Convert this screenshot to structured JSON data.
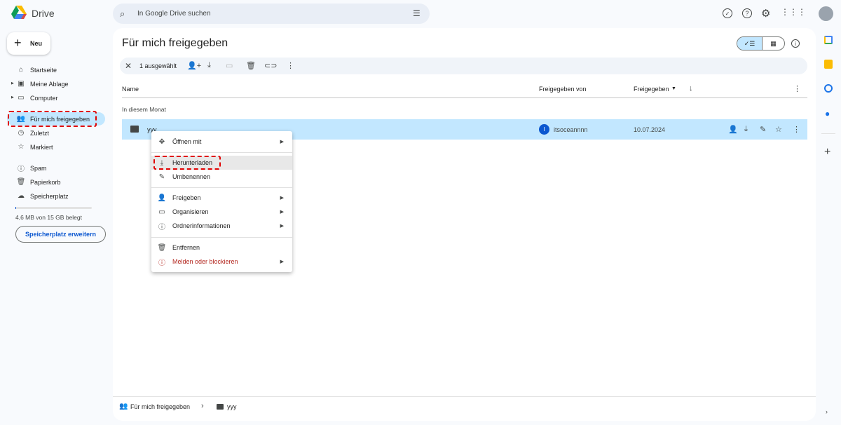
{
  "app": {
    "name": "Drive"
  },
  "search": {
    "placeholder": "In Google Drive suchen"
  },
  "new_button": "Neu",
  "sidebar": {
    "items": [
      {
        "label": "Startseite",
        "icon": "home-icon"
      },
      {
        "label": "Meine Ablage",
        "icon": "my-drive-icon"
      },
      {
        "label": "Computer",
        "icon": "computer-icon"
      },
      {
        "label": "Für mich freigegeben",
        "icon": "shared-icon",
        "active": true
      },
      {
        "label": "Zuletzt",
        "icon": "clock-icon"
      },
      {
        "label": "Markiert",
        "icon": "star-icon"
      },
      {
        "label": "Spam",
        "icon": "spam-icon"
      },
      {
        "label": "Papierkorb",
        "icon": "trash-icon"
      },
      {
        "label": "Speicherplatz",
        "icon": "cloud-icon"
      }
    ],
    "storage_text": "4,6 MB von 15 GB belegt",
    "storage_fraction": 0.0003,
    "storage_button": "Speicherplatz erweitern"
  },
  "main": {
    "title": "Für mich freigegeben",
    "toolbar": {
      "selected": "1 ausgewählt"
    },
    "columns": {
      "name": "Name",
      "shared_by": "Freigegeben von",
      "shared": "Freigegeben"
    },
    "group": "In diesem Monat",
    "rows": [
      {
        "name": "yyy",
        "owner_initial": "I",
        "owner": "itsoceannnn",
        "date": "10.07.2024"
      }
    ]
  },
  "context_menu": {
    "items": [
      {
        "label": "Öffnen mit"
      },
      {
        "label": "Herunterladen"
      },
      {
        "label": "Umbenennen"
      },
      {
        "label": "Freigeben"
      },
      {
        "label": "Organisieren"
      },
      {
        "label": "Ordnerinformationen"
      },
      {
        "label": "Entfernen"
      },
      {
        "label": "Melden oder blockieren"
      }
    ]
  },
  "breadcrumb": {
    "root": "Für mich freigegeben",
    "current": "yyy"
  },
  "colors": {
    "accent": "#0b57d0",
    "selected": "#c2e7ff",
    "danger": "#b3261e",
    "highlight": "#e00000"
  }
}
